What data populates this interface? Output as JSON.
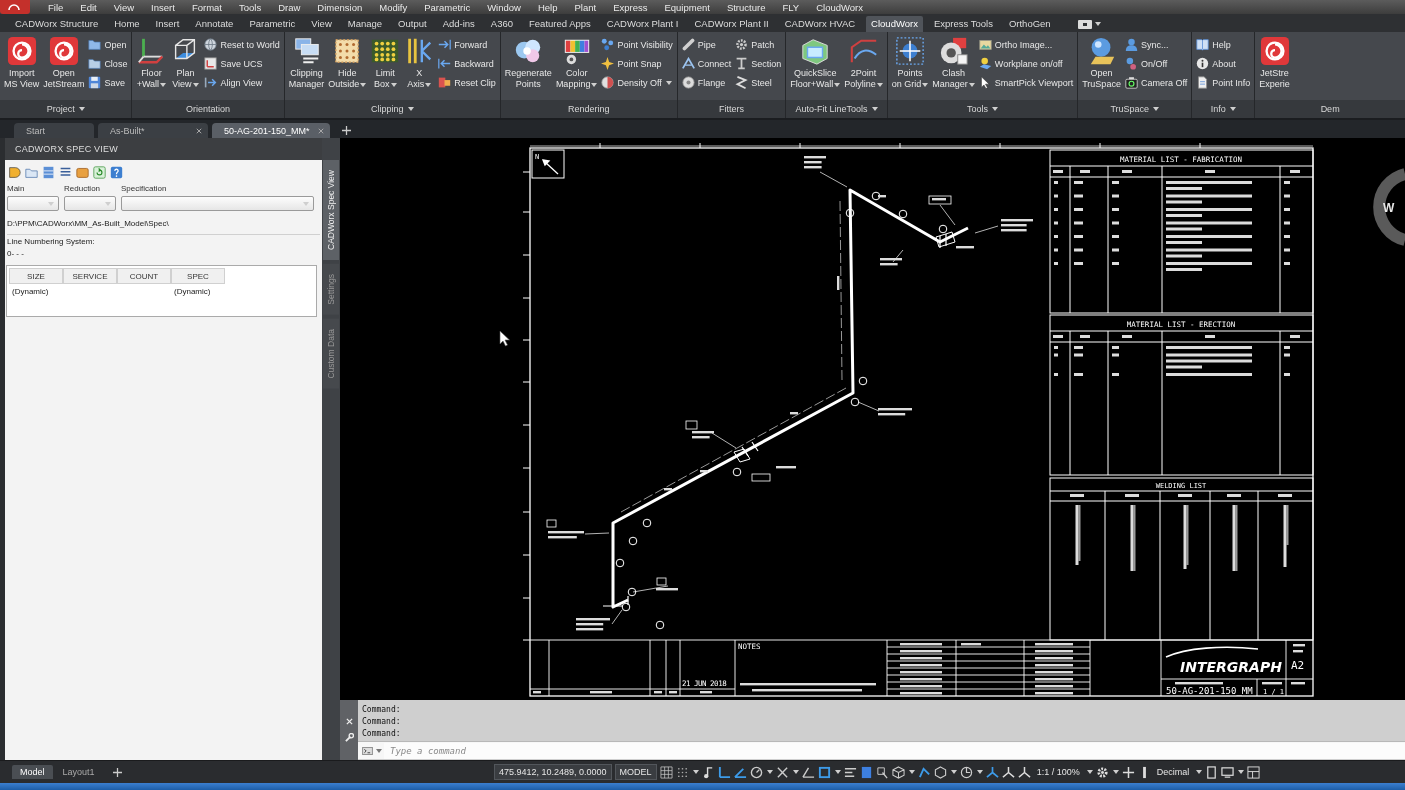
{
  "menu_bar": {
    "items": [
      "File",
      "Edit",
      "View",
      "Insert",
      "Format",
      "Tools",
      "Draw",
      "Dimension",
      "Modify",
      "Parametric",
      "Window",
      "Help",
      "Plant",
      "Express",
      "Equipment",
      "Structure",
      "FLY",
      "CloudWorx"
    ]
  },
  "ribbon_tabs": [
    {
      "label": "CADWorx Structure",
      "selected": false
    },
    {
      "label": "Home",
      "selected": false
    },
    {
      "label": "Insert",
      "selected": false
    },
    {
      "label": "Annotate",
      "selected": false
    },
    {
      "label": "Parametric",
      "selected": false
    },
    {
      "label": "View",
      "selected": false
    },
    {
      "label": "Manage",
      "selected": false
    },
    {
      "label": "Output",
      "selected": false
    },
    {
      "label": "Add-ins",
      "selected": false
    },
    {
      "label": "A360",
      "selected": false
    },
    {
      "label": "Featured Apps",
      "selected": false
    },
    {
      "label": "CADWorx Plant I",
      "selected": false
    },
    {
      "label": "CADWorx Plant II",
      "selected": false
    },
    {
      "label": "CADWorx HVAC",
      "selected": false
    },
    {
      "label": "CloudWorx",
      "selected": true
    },
    {
      "label": "Express Tools",
      "selected": false
    },
    {
      "label": "OrthoGen",
      "selected": false
    }
  ],
  "ribbon_panels": [
    {
      "title": "Project",
      "dropdown": true,
      "groups": [
        {
          "kind": "large",
          "label": "Import\nMS View",
          "dropdown": false
        },
        {
          "kind": "large",
          "label": "Open\nJetStream",
          "dropdown": false
        },
        {
          "kind": "stack",
          "items": [
            {
              "label": "Open",
              "dropdown": false
            },
            {
              "label": "Close",
              "dropdown": false
            },
            {
              "label": "Save",
              "dropdown": false
            }
          ]
        }
      ]
    },
    {
      "title": "Orientation",
      "dropdown": false,
      "groups": [
        {
          "kind": "large",
          "label": "Floor\n+Wall",
          "dropdown": true
        },
        {
          "kind": "large",
          "label": "Plan\nView",
          "dropdown": true
        },
        {
          "kind": "stack",
          "items": [
            {
              "label": "Reset to World",
              "dropdown": false
            },
            {
              "label": "Save UCS",
              "dropdown": false
            },
            {
              "label": "Align View",
              "dropdown": false
            }
          ]
        }
      ]
    },
    {
      "title": "Clipping",
      "dropdown": true,
      "groups": [
        {
          "kind": "large",
          "label": "Clipping\nManager",
          "dropdown": false
        },
        {
          "kind": "large",
          "label": "Hide\nOutside",
          "dropdown": true
        },
        {
          "kind": "large",
          "label": "Limit\nBox",
          "dropdown": true
        },
        {
          "kind": "large",
          "label": "X\nAxis",
          "dropdown": true
        },
        {
          "kind": "stack",
          "items": [
            {
              "label": "Forward",
              "dropdown": false
            },
            {
              "label": "Backward",
              "dropdown": false
            },
            {
              "label": "Reset Clip",
              "dropdown": false
            }
          ]
        }
      ]
    },
    {
      "title": "Rendering",
      "dropdown": false,
      "groups": [
        {
          "kind": "large",
          "label": "Regenerate\nPoints",
          "dropdown": false
        },
        {
          "kind": "large",
          "label": "Color\nMapping",
          "dropdown": true
        },
        {
          "kind": "stack",
          "items": [
            {
              "label": "Point Visibility",
              "dropdown": false
            },
            {
              "label": "Point Snap",
              "dropdown": false
            },
            {
              "label": "Density Off",
              "dropdown": true
            }
          ]
        }
      ]
    },
    {
      "title": "Fitters",
      "dropdown": false,
      "groups": [
        {
          "kind": "stack",
          "items": [
            {
              "label": "Pipe",
              "dropdown": false
            },
            {
              "label": "Connect",
              "dropdown": false
            },
            {
              "label": "Flange",
              "dropdown": false
            }
          ]
        },
        {
          "kind": "stack",
          "items": [
            {
              "label": "Patch",
              "dropdown": false
            },
            {
              "label": "Section",
              "dropdown": false
            },
            {
              "label": "Steel",
              "dropdown": false
            }
          ]
        }
      ]
    },
    {
      "title": "Auto-Fit LineTools",
      "dropdown": true,
      "groups": [
        {
          "kind": "large",
          "label": "QuickSlice\nFloor+Wall",
          "dropdown": true
        },
        {
          "kind": "large",
          "label": "2Point\nPolyline",
          "dropdown": true
        }
      ]
    },
    {
      "title": "Tools",
      "dropdown": true,
      "groups": [
        {
          "kind": "large",
          "label": "Points\non Grid",
          "dropdown": true
        },
        {
          "kind": "large",
          "label": "Clash\nManager",
          "dropdown": true
        },
        {
          "kind": "stack",
          "items": [
            {
              "label": "Ortho Image...",
              "dropdown": false
            },
            {
              "label": "Workplane on/off",
              "dropdown": false
            },
            {
              "label": "SmartPick Viewport",
              "dropdown": false
            }
          ]
        }
      ]
    },
    {
      "title": "TruSpace",
      "dropdown": true,
      "groups": [
        {
          "kind": "large",
          "label": "Open\nTruSpace",
          "dropdown": false
        },
        {
          "kind": "stack",
          "items": [
            {
              "label": "Sync...",
              "dropdown": false
            },
            {
              "label": "On/Off",
              "dropdown": false
            },
            {
              "label": "Camera Off",
              "dropdown": false
            }
          ]
        }
      ]
    },
    {
      "title": "Info",
      "dropdown": true,
      "groups": [
        {
          "kind": "stack",
          "items": [
            {
              "label": "Help",
              "dropdown": false
            },
            {
              "label": "About",
              "dropdown": false
            },
            {
              "label": "Point Info",
              "dropdown": false
            }
          ]
        }
      ]
    },
    {
      "title": "Dem",
      "dropdown": false,
      "groups": [
        {
          "kind": "large",
          "label": "JetStre\nExperie",
          "dropdown": false
        }
      ]
    }
  ],
  "document_tabs": [
    {
      "label": "Start",
      "selected": false,
      "closable": false
    },
    {
      "label": "As-Built*",
      "selected": false,
      "closable": true
    },
    {
      "label": "50-AG-201-150_MM*",
      "selected": true,
      "closable": true
    }
  ],
  "palette": {
    "title": "CADWORX SPEC VIEW",
    "dropdowns": [
      {
        "label": "Main"
      },
      {
        "label": "Reduction"
      },
      {
        "label": "Specification"
      }
    ],
    "spec_path": "D:\\PPM\\CADWorx\\MM_As-Built_Model\\Spec\\",
    "line_numbering_label": "Line Numbering System:",
    "line_numbering_value": "0- - -",
    "table": {
      "columns": [
        "SIZE",
        "SERVICE",
        "COUNT",
        "SPEC"
      ],
      "rows": [
        [
          "(Dynamic)",
          null,
          null,
          "(Dynamic)"
        ]
      ]
    },
    "side_tabs": [
      {
        "label": "CADWorx Spec View",
        "selected": true
      },
      {
        "label": "Settings",
        "selected": false
      },
      {
        "label": "Custom Data",
        "selected": false
      }
    ]
  },
  "drawing": {
    "north_label": "N",
    "tables": [
      {
        "kind": "material",
        "title": "MATERIAL LIST - FABRICATION"
      },
      {
        "kind": "material",
        "title": "MATERIAL LIST - ERECTION"
      },
      {
        "kind": "welding",
        "title": "WELDING LIST"
      }
    ],
    "title_block": {
      "notes_label": "NOTES",
      "date": "21 JUN 2018",
      "logo": "INTERGRAPH",
      "size": "A2",
      "drawing_number": "50-AG-201-150_MM",
      "sheet": "1 / 1"
    }
  },
  "viewcube": {
    "label": "W"
  },
  "command_line": {
    "history": [
      "Command:",
      "Command:",
      "Command:"
    ],
    "placeholder": "Type a command"
  },
  "status_bar": {
    "layout_tabs": [
      {
        "label": "Model",
        "selected": true
      },
      {
        "label": "Layout1",
        "selected": false
      }
    ],
    "coordinates": "475.9412, 10.2489, 0.0000",
    "space": "MODEL",
    "annotation_scale": "1:1 / 100%",
    "units": "Decimal"
  }
}
